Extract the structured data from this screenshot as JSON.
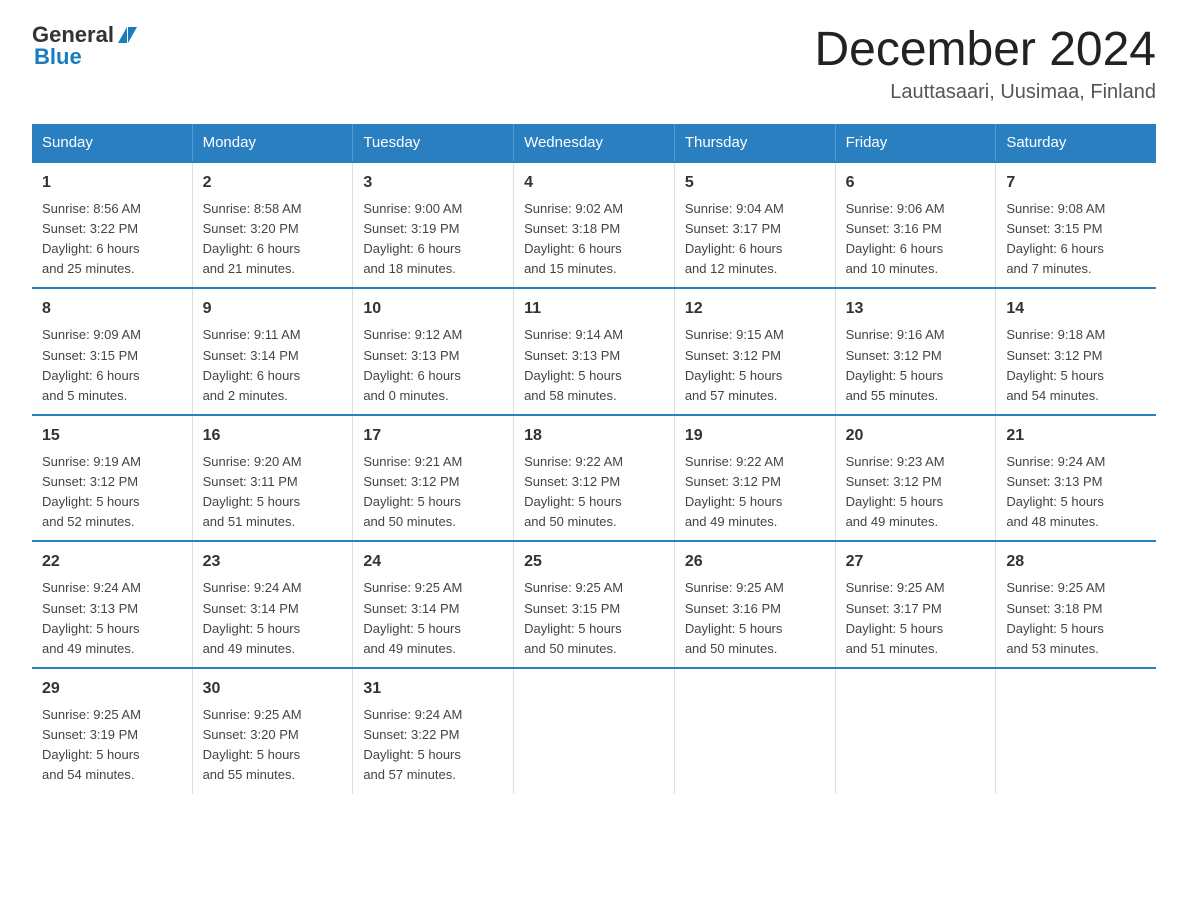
{
  "header": {
    "logo_general": "General",
    "logo_blue": "Blue",
    "title": "December 2024",
    "subtitle": "Lauttasaari, Uusimaa, Finland"
  },
  "columns": [
    "Sunday",
    "Monday",
    "Tuesday",
    "Wednesday",
    "Thursday",
    "Friday",
    "Saturday"
  ],
  "weeks": [
    [
      {
        "day": "1",
        "info": "Sunrise: 8:56 AM\nSunset: 3:22 PM\nDaylight: 6 hours\nand 25 minutes."
      },
      {
        "day": "2",
        "info": "Sunrise: 8:58 AM\nSunset: 3:20 PM\nDaylight: 6 hours\nand 21 minutes."
      },
      {
        "day": "3",
        "info": "Sunrise: 9:00 AM\nSunset: 3:19 PM\nDaylight: 6 hours\nand 18 minutes."
      },
      {
        "day": "4",
        "info": "Sunrise: 9:02 AM\nSunset: 3:18 PM\nDaylight: 6 hours\nand 15 minutes."
      },
      {
        "day": "5",
        "info": "Sunrise: 9:04 AM\nSunset: 3:17 PM\nDaylight: 6 hours\nand 12 minutes."
      },
      {
        "day": "6",
        "info": "Sunrise: 9:06 AM\nSunset: 3:16 PM\nDaylight: 6 hours\nand 10 minutes."
      },
      {
        "day": "7",
        "info": "Sunrise: 9:08 AM\nSunset: 3:15 PM\nDaylight: 6 hours\nand 7 minutes."
      }
    ],
    [
      {
        "day": "8",
        "info": "Sunrise: 9:09 AM\nSunset: 3:15 PM\nDaylight: 6 hours\nand 5 minutes."
      },
      {
        "day": "9",
        "info": "Sunrise: 9:11 AM\nSunset: 3:14 PM\nDaylight: 6 hours\nand 2 minutes."
      },
      {
        "day": "10",
        "info": "Sunrise: 9:12 AM\nSunset: 3:13 PM\nDaylight: 6 hours\nand 0 minutes."
      },
      {
        "day": "11",
        "info": "Sunrise: 9:14 AM\nSunset: 3:13 PM\nDaylight: 5 hours\nand 58 minutes."
      },
      {
        "day": "12",
        "info": "Sunrise: 9:15 AM\nSunset: 3:12 PM\nDaylight: 5 hours\nand 57 minutes."
      },
      {
        "day": "13",
        "info": "Sunrise: 9:16 AM\nSunset: 3:12 PM\nDaylight: 5 hours\nand 55 minutes."
      },
      {
        "day": "14",
        "info": "Sunrise: 9:18 AM\nSunset: 3:12 PM\nDaylight: 5 hours\nand 54 minutes."
      }
    ],
    [
      {
        "day": "15",
        "info": "Sunrise: 9:19 AM\nSunset: 3:12 PM\nDaylight: 5 hours\nand 52 minutes."
      },
      {
        "day": "16",
        "info": "Sunrise: 9:20 AM\nSunset: 3:11 PM\nDaylight: 5 hours\nand 51 minutes."
      },
      {
        "day": "17",
        "info": "Sunrise: 9:21 AM\nSunset: 3:12 PM\nDaylight: 5 hours\nand 50 minutes."
      },
      {
        "day": "18",
        "info": "Sunrise: 9:22 AM\nSunset: 3:12 PM\nDaylight: 5 hours\nand 50 minutes."
      },
      {
        "day": "19",
        "info": "Sunrise: 9:22 AM\nSunset: 3:12 PM\nDaylight: 5 hours\nand 49 minutes."
      },
      {
        "day": "20",
        "info": "Sunrise: 9:23 AM\nSunset: 3:12 PM\nDaylight: 5 hours\nand 49 minutes."
      },
      {
        "day": "21",
        "info": "Sunrise: 9:24 AM\nSunset: 3:13 PM\nDaylight: 5 hours\nand 48 minutes."
      }
    ],
    [
      {
        "day": "22",
        "info": "Sunrise: 9:24 AM\nSunset: 3:13 PM\nDaylight: 5 hours\nand 49 minutes."
      },
      {
        "day": "23",
        "info": "Sunrise: 9:24 AM\nSunset: 3:14 PM\nDaylight: 5 hours\nand 49 minutes."
      },
      {
        "day": "24",
        "info": "Sunrise: 9:25 AM\nSunset: 3:14 PM\nDaylight: 5 hours\nand 49 minutes."
      },
      {
        "day": "25",
        "info": "Sunrise: 9:25 AM\nSunset: 3:15 PM\nDaylight: 5 hours\nand 50 minutes."
      },
      {
        "day": "26",
        "info": "Sunrise: 9:25 AM\nSunset: 3:16 PM\nDaylight: 5 hours\nand 50 minutes."
      },
      {
        "day": "27",
        "info": "Sunrise: 9:25 AM\nSunset: 3:17 PM\nDaylight: 5 hours\nand 51 minutes."
      },
      {
        "day": "28",
        "info": "Sunrise: 9:25 AM\nSunset: 3:18 PM\nDaylight: 5 hours\nand 53 minutes."
      }
    ],
    [
      {
        "day": "29",
        "info": "Sunrise: 9:25 AM\nSunset: 3:19 PM\nDaylight: 5 hours\nand 54 minutes."
      },
      {
        "day": "30",
        "info": "Sunrise: 9:25 AM\nSunset: 3:20 PM\nDaylight: 5 hours\nand 55 minutes."
      },
      {
        "day": "31",
        "info": "Sunrise: 9:24 AM\nSunset: 3:22 PM\nDaylight: 5 hours\nand 57 minutes."
      },
      {
        "day": "",
        "info": ""
      },
      {
        "day": "",
        "info": ""
      },
      {
        "day": "",
        "info": ""
      },
      {
        "day": "",
        "info": ""
      }
    ]
  ]
}
